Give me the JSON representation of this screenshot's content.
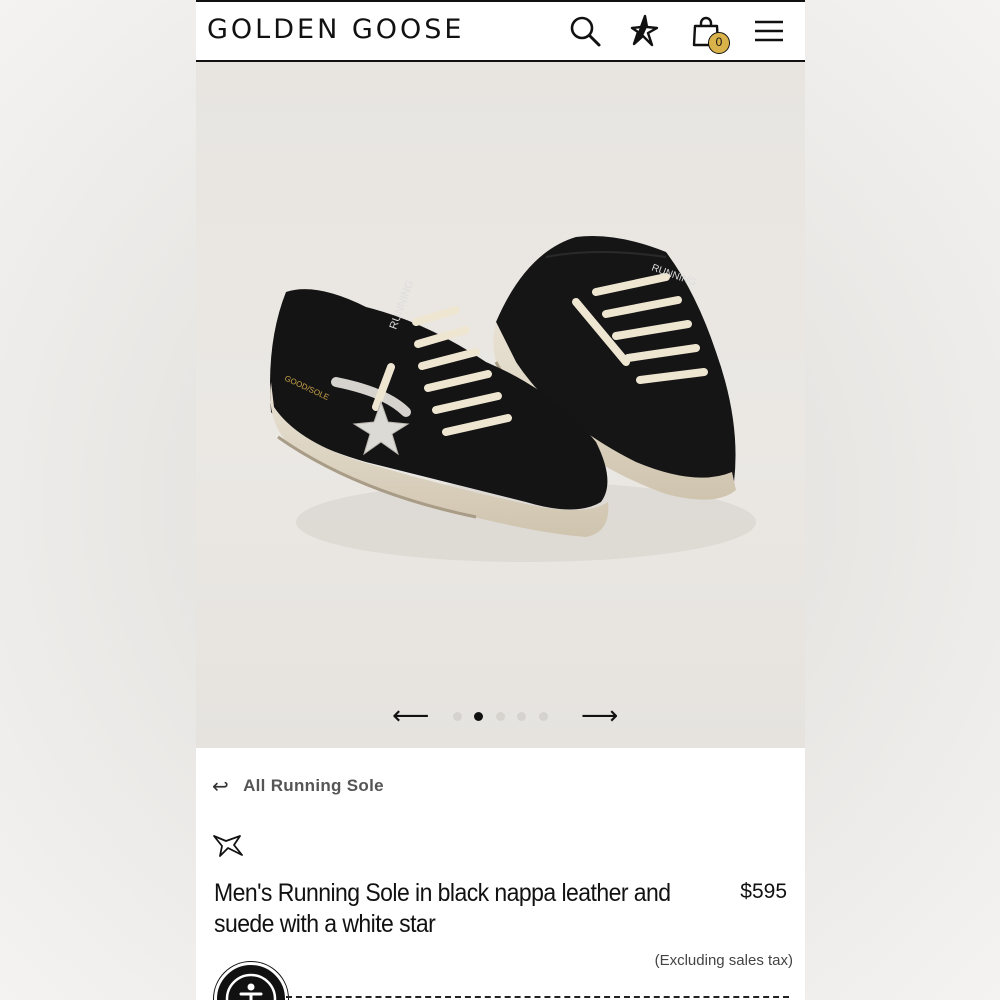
{
  "header": {
    "brand": "GOLDEN GOOSE",
    "icons": [
      "search-icon",
      "star-account-icon",
      "bag-icon",
      "menu-icon"
    ],
    "cart_count": "0",
    "badge_color": "#d9b24a"
  },
  "gallery": {
    "prev_label": "⟵",
    "next_label": "⟶",
    "slides": 5,
    "active_slide": 2,
    "image_text": {
      "tongue_label": "RUNNING",
      "heel_label": "GOOD/SOLE"
    }
  },
  "breadcrumb": {
    "back_label": "All Running Sole"
  },
  "product": {
    "title": "Men's Running Sole in black nappa leather and suede with a white star",
    "price": "$595",
    "tax_note": "(Excluding sales tax)"
  }
}
